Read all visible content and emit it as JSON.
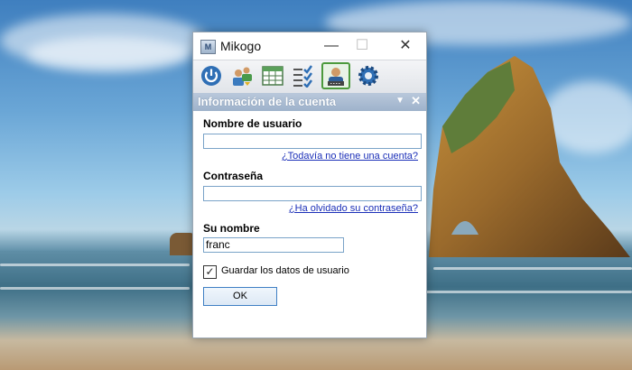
{
  "window": {
    "app_icon_text": "M",
    "title": "Mikogo",
    "minimize_glyph": "—",
    "maximize_glyph": "☐",
    "close_glyph": "✕"
  },
  "toolbar": {
    "buttons": [
      {
        "name": "power-icon",
        "active": false
      },
      {
        "name": "participants-icon",
        "active": false
      },
      {
        "name": "schedule-grid-icon",
        "active": false
      },
      {
        "name": "checklist-icon",
        "active": false
      },
      {
        "name": "account-user-icon",
        "active": true
      },
      {
        "name": "settings-gear-icon",
        "active": false
      }
    ]
  },
  "panel": {
    "title": "Información de la cuenta",
    "dropdown_glyph": "▼",
    "close_glyph": "✕"
  },
  "form": {
    "username_label": "Nombre de usuario",
    "username_value": "",
    "no_account_link": "¿Todavía no tiene una cuenta?",
    "password_label": "Contraseña",
    "password_value": "",
    "forgot_link": "¿Ha olvidado su contraseña?",
    "name_label": "Su nombre",
    "name_value": "franc",
    "save_checked_glyph": "✓",
    "save_label": "Guardar los datos de usuario",
    "ok_label": "OK"
  },
  "colors": {
    "accent_active": "#4c9a3d",
    "panel_header": "#9eb2cb",
    "link": "#1b2fb8"
  }
}
